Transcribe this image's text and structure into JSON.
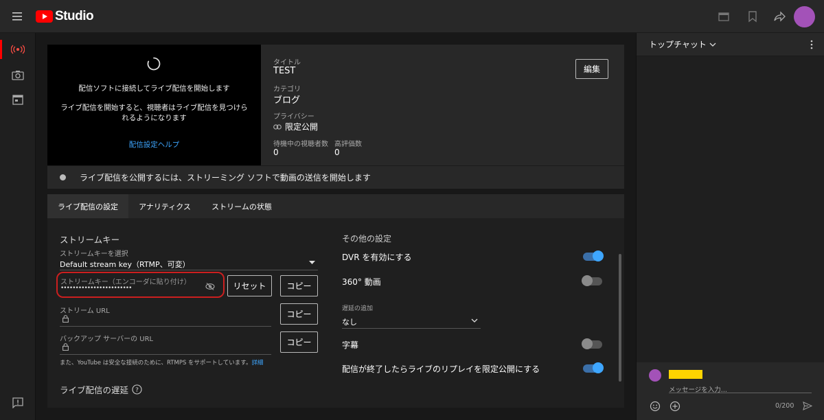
{
  "header": {
    "app_name": "Studio"
  },
  "preview": {
    "connect_text": "配信ソフトに接続してライブ配信を開始します",
    "info_line1": "ライブ配信を開始すると、視聴者はライブ配信を見つけら",
    "info_line2": "れるようになります",
    "help_link": "配信設定ヘルプ"
  },
  "details": {
    "title_label": "タイトル",
    "title_value": "TEST",
    "category_label": "カテゴリ",
    "category_value": "ブログ",
    "privacy_label": "プライバシー",
    "privacy_value": "限定公開",
    "waiting_label": "待機中の視聴者数",
    "waiting_value": "0",
    "likes_label": "高評価数",
    "likes_value": "0",
    "edit_button": "編集"
  },
  "status_bar": {
    "text": "ライブ配信を公開するには、ストリーミング ソフトで動画の送信を開始します"
  },
  "tabs": [
    {
      "label": "ライブ配信の設定",
      "active": true
    },
    {
      "label": "アナリティクス",
      "active": false
    },
    {
      "label": "ストリームの状態",
      "active": false
    }
  ],
  "stream_key": {
    "section_title": "ストリームキー",
    "select_label": "ストリームキーを選択",
    "select_value": "Default stream key（RTMP、可変）",
    "key_label": "ストリームキー（エンコーダに貼り付け）",
    "key_value": "••••••••••••••••••••••••",
    "reset_button": "リセット",
    "copy_button_1": "コピー",
    "url_label": "ストリーム URL",
    "copy_button_2": "コピー",
    "backup_label": "バックアップ サーバーの URL",
    "copy_button_3": "コピー",
    "rtmps_note": "また、YouTube は安全な接続のために、RTMPS をサポートしています。",
    "rtmps_link": "詳細",
    "latency_title": "ライブ配信の遅延"
  },
  "other_settings": {
    "section_title": "その他の設定",
    "dvr_label": "DVR を有効にする",
    "dvr_on": true,
    "video360_label": "360° 動画",
    "video360_on": false,
    "delay_label": "遅延の追加",
    "delay_value": "なし",
    "captions_label": "字幕",
    "captions_on": false,
    "replay_label": "配信が終了したらライブのリプレイを限定公開にする",
    "replay_on": true
  },
  "chat": {
    "header_label": "トップチャット",
    "input_placeholder": "メッセージを入力...",
    "char_count": "0/200"
  },
  "colors": {
    "accent_blue": "#3ea6ff",
    "youtube_red": "#ff0000",
    "highlight_red": "#cc1f1f",
    "avatar_purple": "#a352b8",
    "redacted_yellow": "#ffd400"
  }
}
